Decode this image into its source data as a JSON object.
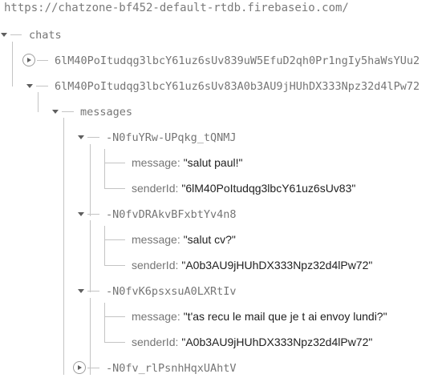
{
  "root_url": "https://chatzone-bf452-default-rtdb.firebaseio.com/",
  "tree": {
    "chats_key": "chats",
    "chat_collapsed_key": "6lM40PoItudqg3lbcY61uz6sUv839uW5EfuD2qh0Pr1ngIy5haWsYUu2",
    "chat_expanded_key": "6lM40PoItudqg3lbcY61uz6sUv83A0b3AU9jHUhDX333Npz32d4lPw72",
    "messages_key": "messages",
    "msg1": {
      "id": "-N0fuYRw-UPqkg_tQNMJ",
      "message_key": "message",
      "message_value": "\"salut paul!\"",
      "sender_key": "senderId",
      "sender_value": "\"6lM40PoItudqg3lbcY61uz6sUv83\""
    },
    "msg2": {
      "id": "-N0fvDRAkvBFxbtYv4n8",
      "message_key": "message",
      "message_value": "\"salut cv?\"",
      "sender_key": "senderId",
      "sender_value": "\"A0b3AU9jHUhDX333Npz32d4lPw72\""
    },
    "msg3": {
      "id": "-N0fvK6psxsuA0LXRtIv",
      "message_key": "message",
      "message_value": "\"t'as recu le mail que je t ai envoy lundi?\"",
      "sender_key": "senderId",
      "sender_value": "\"A0b3AU9jHUhDX333Npz32d4lPw72\""
    },
    "msg4_collapsed_id": "-N0fv_rlPsnhHqxUAhtV"
  },
  "colon": ":"
}
